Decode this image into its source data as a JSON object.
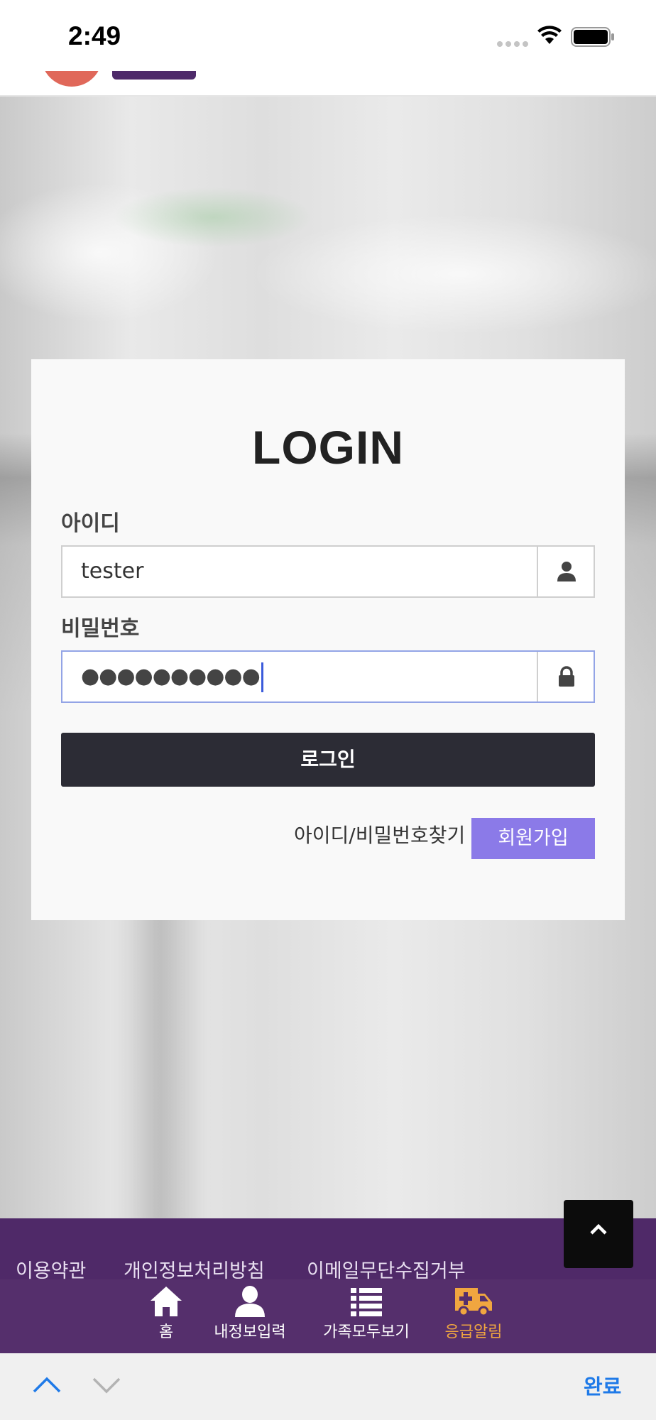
{
  "status_bar": {
    "time": "2:49"
  },
  "login": {
    "title": "LOGIN",
    "id_label": "아이디",
    "id_value": "tester",
    "password_label": "비밀번호",
    "password_masked": "●●●●●●●●●●",
    "login_button": "로그인",
    "find_link": "아이디/비밀번호찾기",
    "signup_button": "회원가입"
  },
  "footer": {
    "links": [
      "이용약관",
      "개인정보처리방침",
      "이메일무단수집거부"
    ],
    "nav": [
      {
        "label": "홈",
        "icon": "home-icon"
      },
      {
        "label": "내정보입력",
        "icon": "person-icon"
      },
      {
        "label": "가족모두보기",
        "icon": "list-icon"
      },
      {
        "label": "응급알림",
        "icon": "ambulance-icon"
      }
    ]
  },
  "keyboard_bar": {
    "done_label": "완료"
  },
  "colors": {
    "footer_bg": "#4f2968",
    "nav_active": "#f0a640",
    "signup_bg": "#8b7ae8",
    "login_bg": "#2c2c35",
    "done_blue": "#1f7ae8"
  }
}
